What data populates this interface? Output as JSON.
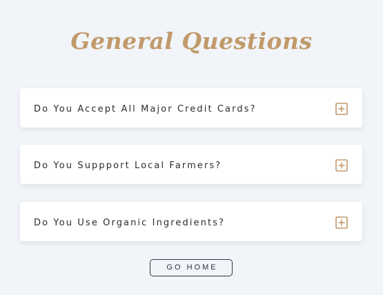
{
  "heading": "General Questions",
  "faq": [
    {
      "question": "Do You Accept All Major Credit Cards?",
      "icon": "plus-square-icon"
    },
    {
      "question": "Do You Suppport Local Farmers?",
      "icon": "plus-square-icon"
    },
    {
      "question": "Do You Use Organic Ingredients?",
      "icon": "plus-square-icon"
    }
  ],
  "button": {
    "label": "GO HOME"
  },
  "colors": {
    "background": "#f1f4f8",
    "accent": "#c19a6b",
    "card": "#ffffff",
    "text": "#2c2c2c",
    "button_border": "#2c3440"
  }
}
